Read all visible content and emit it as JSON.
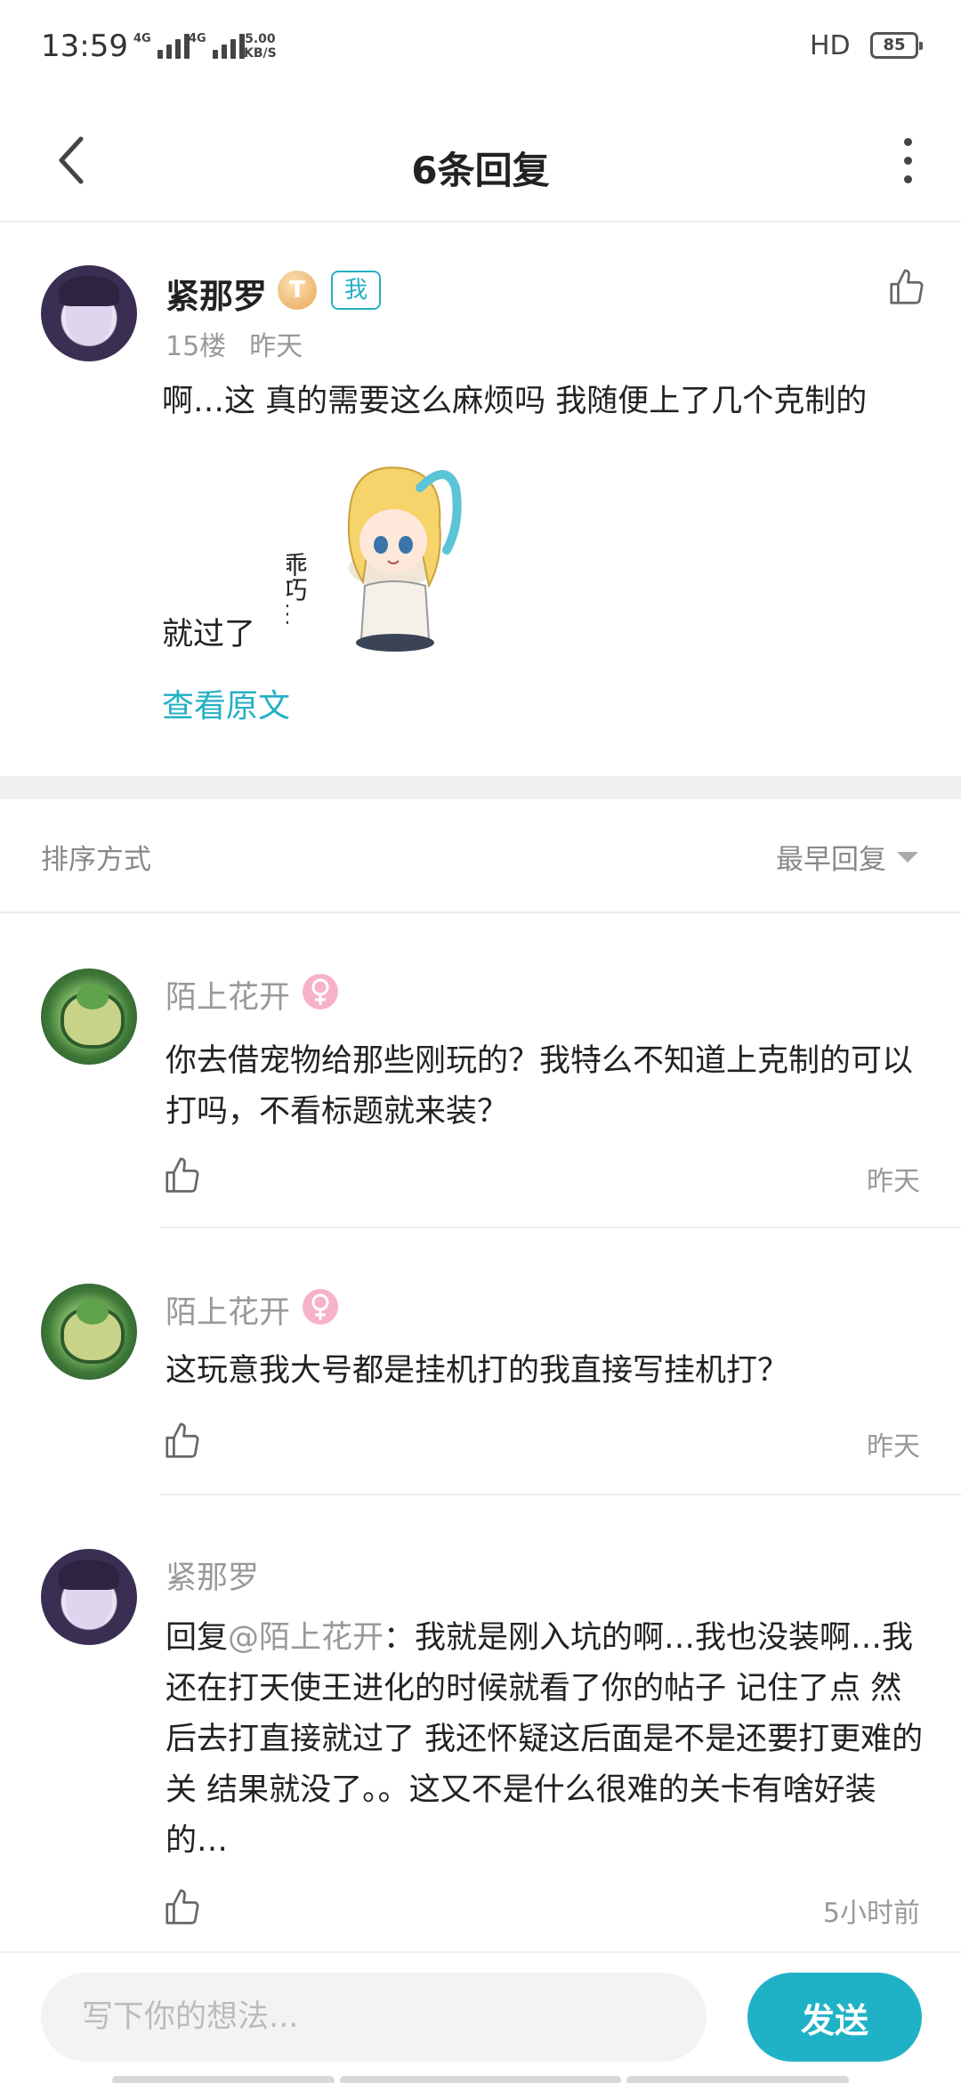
{
  "status_bar": {
    "time": "13:59",
    "network1": "4G",
    "network2": "4G",
    "speed_value": "5.00",
    "speed_unit": "KB/S",
    "hd": "HD",
    "battery": "85"
  },
  "header": {
    "title": "6条回复"
  },
  "main_post": {
    "author": "紧那罗",
    "level_badge": "T",
    "me_badge": "我",
    "floor": "15楼",
    "time": "昨天",
    "text_line1": "啊…这 真的需要这么麻烦吗 我随便上了几个克制的",
    "text_line2": "就过了",
    "sticker_text": "乖巧…",
    "view_original": "查看原文"
  },
  "sort": {
    "label": "排序方式",
    "selected": "最早回复"
  },
  "replies": [
    {
      "author": "陌上花开",
      "text": "你去借宠物给那些刚玩的？我特么不知道上克制的可以打吗，不看标题就来装？",
      "time": "昨天"
    },
    {
      "author": "陌上花开",
      "text": "这玩意我大号都是挂机打的我直接写挂机打？",
      "time": "昨天"
    },
    {
      "author": "紧那罗",
      "reply_prefix": "回复",
      "mention": "@陌上花开",
      "text": "：我就是刚入坑的啊…我也没装啊…我还在打天使王进化的时候就看了你的帖子 记住了点 然后去打直接就过了 我还怀疑这后面是不是还要打更难的关 结果就没了。。这又不是什么很难的关卡有啥好装的…",
      "time": "5小时前"
    }
  ],
  "composer": {
    "placeholder": "写下你的想法...",
    "send_label": "发送"
  },
  "colors": {
    "accent": "#1fb2c6",
    "muted": "#999999",
    "female_badge": "#f28db2"
  }
}
